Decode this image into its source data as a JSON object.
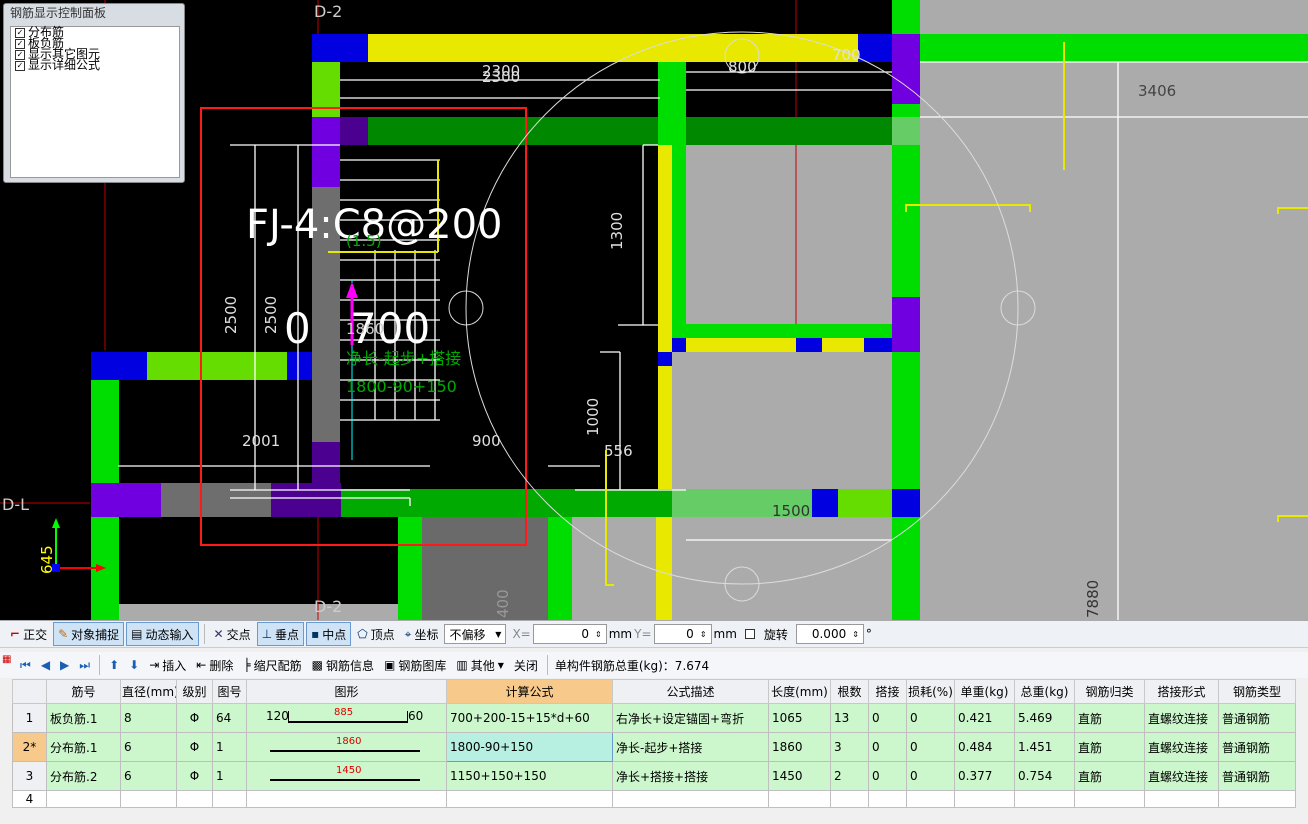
{
  "panel": {
    "title": "钢筋显示控制面板",
    "options": [
      {
        "label": "分布筋",
        "checked": true
      },
      {
        "label": "板负筋",
        "checked": true
      },
      {
        "label": "显示其它图元",
        "checked": true
      },
      {
        "label": "显示详细公式",
        "checked": true
      }
    ]
  },
  "cad": {
    "axes": {
      "top": "D-2",
      "left": "D-L",
      "bottom": "D-2"
    },
    "big_label": "FJ-4:C8@200",
    "big_sub": "(1.5)",
    "big_nums": {
      "left": "0",
      "right": "700"
    },
    "small_num": "1860",
    "green_formula_desc": "净长-起步+搭接",
    "green_formula": "1800-90+150",
    "dims": [
      "2300",
      "2300",
      "800",
      "700",
      "3406",
      "1300",
      "2500",
      "2500",
      "2001",
      "900",
      "1000",
      "556",
      "1500",
      "645",
      "400",
      "7880"
    ]
  },
  "toolbar1": {
    "ortho": "正交",
    "snap": "对象捕捉",
    "dyn": "动态输入",
    "intersect": "交点",
    "perp": "垂点",
    "mid": "中点",
    "vertex": "顶点",
    "coord": "坐标",
    "offset_mode": "不偏移",
    "x_label": "X=",
    "x_value": "0",
    "y_label": "Y=",
    "y_value": "0",
    "unit": "mm",
    "rotate_label": "旋转",
    "rotate_value": "0.000",
    "degree": "°"
  },
  "toolbar2": {
    "insert": "插入",
    "delete": "删除",
    "scale": "缩尺配筋",
    "info": "钢筋信息",
    "lib": "钢筋图库",
    "other": "其他",
    "close": "关闭",
    "total_weight": "单构件钢筋总重(kg)：7.674"
  },
  "table": {
    "headers": [
      "",
      "筋号",
      "直径(mm)",
      "级别",
      "图号",
      "图形",
      "计算公式",
      "公式描述",
      "长度(mm)",
      "根数",
      "搭接",
      "损耗(%)",
      "单重(kg)",
      "总重(kg)",
      "钢筋归类",
      "搭接形式",
      "钢筋类型"
    ],
    "rows": [
      {
        "rn": "1",
        "name": "板负筋.1",
        "dia": "8",
        "grade": "Φ",
        "fig": "64",
        "shape_left": "120",
        "shape_mid": "885",
        "shape_right": "60",
        "formula": "700+200-15+15*d+60",
        "desc": "右净长+设定锚固+弯折",
        "len": "1065",
        "count": "13",
        "lap": "0",
        "loss": "0",
        "unit_w": "0.421",
        "total_w": "5.469",
        "cls": "直筋",
        "lap_type": "直螺纹连接",
        "type": "普通钢筋"
      },
      {
        "rn": "2*",
        "name": "分布筋.1",
        "dia": "6",
        "grade": "Φ",
        "fig": "1",
        "shape_left": "",
        "shape_mid": "1860",
        "shape_right": "",
        "formula": "1800-90+150",
        "desc": "净长-起步+搭接",
        "len": "1860",
        "count": "3",
        "lap": "0",
        "loss": "0",
        "unit_w": "0.484",
        "total_w": "1.451",
        "cls": "直筋",
        "lap_type": "直螺纹连接",
        "type": "普通钢筋"
      },
      {
        "rn": "3",
        "name": "分布筋.2",
        "dia": "6",
        "grade": "Φ",
        "fig": "1",
        "shape_left": "",
        "shape_mid": "1450",
        "shape_right": "",
        "formula": "1150+150+150",
        "desc": "净长+搭接+搭接",
        "len": "1450",
        "count": "2",
        "lap": "0",
        "loss": "0",
        "unit_w": "0.377",
        "total_w": "0.754",
        "cls": "直筋",
        "lap_type": "直螺纹连接",
        "type": "普通钢筋"
      },
      {
        "rn": "4",
        "name": "",
        "dia": "",
        "grade": "",
        "fig": "",
        "shape_left": "",
        "shape_mid": "",
        "shape_right": "",
        "formula": "",
        "desc": "",
        "len": "",
        "count": "",
        "lap": "",
        "loss": "",
        "unit_w": "",
        "total_w": "",
        "cls": "",
        "lap_type": "",
        "type": ""
      }
    ]
  }
}
